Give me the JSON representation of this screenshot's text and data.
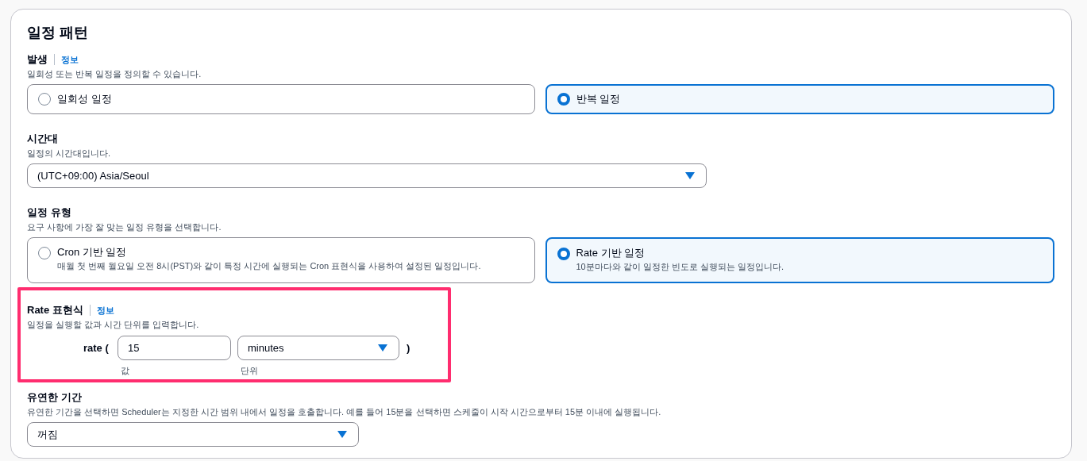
{
  "section": {
    "title": "일정 패턴"
  },
  "occurrence": {
    "label": "발생",
    "info": "정보",
    "description": "일회성 또는 반복 일정을 정의할 수 있습니다.",
    "options": [
      {
        "label": "일회성 일정",
        "selected": false
      },
      {
        "label": "반복 일정",
        "selected": true
      }
    ]
  },
  "timezone": {
    "label": "시간대",
    "description": "일정의 시간대입니다.",
    "value": "(UTC+09:00) Asia/Seoul"
  },
  "schedule_type": {
    "label": "일정 유형",
    "description": "요구 사항에 가장 잘 맞는 일정 유형을 선택합니다.",
    "options": [
      {
        "label": "Cron 기반 일정",
        "description": "매월 첫 번째 월요일 오전 8시(PST)와 같이 특정 시간에 실행되는 Cron 표현식을 사용하여 설정된 일정입니다.",
        "selected": false
      },
      {
        "label": "Rate 기반 일정",
        "description": "10분마다와 같이 일정한 빈도로 실행되는 일정입니다.",
        "selected": true
      }
    ]
  },
  "rate_expression": {
    "highlighted": true,
    "label": "Rate 표현식",
    "info": "정보",
    "description": "일정을 실행할 값과 시간 단위를 입력합니다.",
    "prefix": "rate (",
    "suffix": ")",
    "value": {
      "value": "15",
      "caption": "값"
    },
    "unit": {
      "value": "minutes",
      "caption": "단위"
    }
  },
  "flexible_window": {
    "label": "유연한 기간",
    "description": "유연한 기간을 선택하면 Scheduler는 지정한 시간 범위 내에서 일정을 호출합니다. 예를 들어 15분을 선택하면 스케줄이 시작 시간으로부터 15분 이내에 실행됩니다.",
    "value": "꺼짐"
  }
}
